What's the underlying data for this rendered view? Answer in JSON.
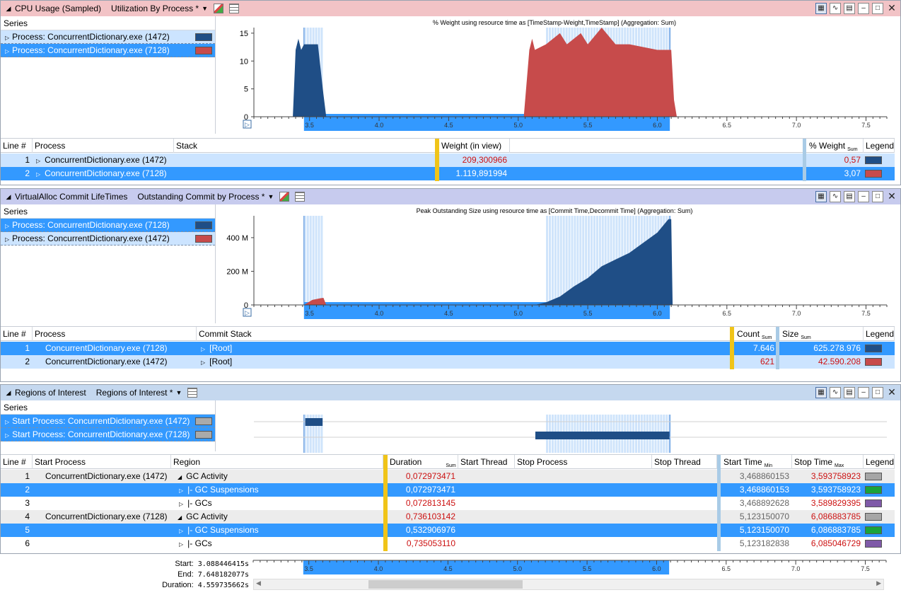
{
  "panels": [
    {
      "title": "CPU Usage (Sampled)",
      "preset": "Utilization By Process *",
      "color": "#f2c3c6",
      "series_header": "Series",
      "series": [
        {
          "label": "Process: ConcurrentDictionary.exe (1472)",
          "color": "#1f4e86"
        },
        {
          "label": "Process: ConcurrentDictionary.exe (7128)",
          "color": "#c74b4b"
        }
      ],
      "chart_title": "% Weight using resource time as [TimeStamp-Weight,TimeStamp] (Aggregation: Sum)",
      "yticks": [
        "15",
        "10",
        "5",
        "0"
      ],
      "columns": [
        "Line #",
        "Process",
        "Stack",
        "Weight (in view)",
        "% Weight",
        "Legend"
      ],
      "sum_label": "Sum",
      "rows": [
        {
          "line": "1",
          "process": "ConcurrentDictionary.exe (1472)",
          "stack": "",
          "weight": "209,300966",
          "pct": "0,57"
        },
        {
          "line": "2",
          "process": "ConcurrentDictionary.exe (7128)",
          "stack": "",
          "weight": "1.119,891994",
          "pct": "3,07"
        }
      ]
    },
    {
      "title": "VirtualAlloc Commit LifeTimes",
      "preset": "Outstanding Commit by Process *",
      "color": "#c7cbee",
      "series_header": "Series",
      "series": [
        {
          "label": "Process: ConcurrentDictionary.exe (7128)",
          "color": "#1f4e86"
        },
        {
          "label": "Process: ConcurrentDictionary.exe (1472)",
          "color": "#c74b4b"
        }
      ],
      "chart_title": "Peak Outstanding Size using resource time as [Commit Time,Decommit Time] (Aggregation: Sum)",
      "yticks": [
        "400 M",
        "200 M",
        "0"
      ],
      "columns": [
        "Line #",
        "Process",
        "Commit Stack",
        "Count",
        "Size",
        "Legend"
      ],
      "sum_label": "Sum",
      "rows": [
        {
          "line": "1",
          "process": "ConcurrentDictionary.exe (7128)",
          "stack": "[Root]",
          "count": "7.646",
          "size": "625.278.976"
        },
        {
          "line": "2",
          "process": "ConcurrentDictionary.exe (1472)",
          "stack": "[Root]",
          "count": "621",
          "size": "42.590.208"
        }
      ]
    },
    {
      "title": "Regions of Interest",
      "preset": "Regions of Interest *",
      "color": "#c5d8ef",
      "series_header": "Series",
      "series": [
        {
          "label": "Start Process: ConcurrentDictionary.exe (1472)",
          "color": "#aaaaaa"
        },
        {
          "label": "Start Process: ConcurrentDictionary.exe (7128)",
          "color": "#aaaaaa"
        }
      ],
      "columns": [
        "Line #",
        "Start Process",
        "Region",
        "Duration",
        "Start Thread",
        "Stop Process",
        "Stop Thread",
        "Start Time",
        "Stop Time",
        "Legend"
      ],
      "sum_label": "Sum",
      "min_label": "Min",
      "max_label": "Max",
      "rows": [
        {
          "line": "1",
          "process": "ConcurrentDictionary.exe (1472)",
          "region": "GC Activity",
          "duration": "0,072973471",
          "start": "3,468860153",
          "stop": "3,593758923",
          "legend": "#a6a6a6",
          "expanded": true
        },
        {
          "line": "2",
          "process": "",
          "region": "|- GC Suspensions",
          "duration": "0,072973471",
          "start": "3,468860153",
          "stop": "3,593758923",
          "legend": "#1aa33a",
          "expanded": false
        },
        {
          "line": "3",
          "process": "",
          "region": "|- GCs",
          "duration": "0,072813145",
          "start": "3,468892628",
          "stop": "3,589829395",
          "legend": "#7f5aa8",
          "expanded": false
        },
        {
          "line": "4",
          "process": "ConcurrentDictionary.exe (7128)",
          "region": "GC Activity",
          "duration": "0,736103142",
          "start": "5,123150070",
          "stop": "6,086883785",
          "legend": "#a6a6a6",
          "expanded": true
        },
        {
          "line": "5",
          "process": "",
          "region": "|- GC Suspensions",
          "duration": "0,532906976",
          "start": "5,123150070",
          "stop": "6,086883785",
          "legend": "#1aa33a",
          "expanded": false
        },
        {
          "line": "6",
          "process": "",
          "region": "|- GCs",
          "duration": "0,735053110",
          "start": "5,123182838",
          "stop": "6,085046729",
          "legend": "#7f5aa8",
          "expanded": false
        }
      ]
    }
  ],
  "xticks": [
    "3.5",
    "4.0",
    "4.5",
    "5.0",
    "5.5",
    "6.0",
    "6.5",
    "7.0",
    "7.5"
  ],
  "footer": {
    "start_label": "Start:",
    "start_value": "3.088446415s",
    "end_label": "End:",
    "end_value": "7.648182077s",
    "duration_label": "Duration:",
    "duration_value": "4.559735662s"
  },
  "chart_data": [
    {
      "type": "area",
      "title": "% Weight using resource time as [TimeStamp-Weight,TimeStamp] (Aggregation: Sum)",
      "xlim": [
        3.1,
        7.65
      ],
      "ylim": [
        0,
        16
      ],
      "series": [
        {
          "name": "Process: ConcurrentDictionary.exe (1472)",
          "x": [
            3.38,
            3.4,
            3.42,
            3.44,
            3.46,
            3.48,
            3.5,
            3.52,
            3.56,
            3.6,
            3.62
          ],
          "y": [
            0,
            12,
            14,
            12,
            13,
            13,
            13,
            13,
            13,
            4,
            0
          ]
        },
        {
          "name": "Process: ConcurrentDictionary.exe (7128)",
          "x": [
            5.04,
            5.08,
            5.1,
            5.12,
            5.2,
            5.3,
            5.35,
            5.45,
            5.5,
            5.6,
            5.7,
            5.8,
            6.0,
            6.1,
            6.12,
            6.14
          ],
          "y": [
            0,
            12,
            14,
            12,
            13,
            15,
            13,
            15,
            13,
            16,
            13,
            13,
            12,
            12,
            3,
            0
          ]
        }
      ]
    },
    {
      "type": "area",
      "title": "Peak Outstanding Size using resource time as [Commit Time,Decommit Time] (Aggregation: Sum)",
      "xlim": [
        3.1,
        7.65
      ],
      "ylim": [
        0,
        530
      ],
      "series": [
        {
          "name": "Process: ConcurrentDictionary.exe (7128)",
          "x": [
            5.12,
            5.2,
            5.3,
            5.4,
            5.5,
            5.6,
            5.7,
            5.8,
            5.9,
            6.0,
            6.08,
            6.1,
            6.11
          ],
          "y": [
            0,
            15,
            50,
            110,
            160,
            230,
            270,
            310,
            370,
            430,
            510,
            510,
            0
          ]
        },
        {
          "name": "Process: ConcurrentDictionary.exe (1472)",
          "x": [
            3.46,
            3.52,
            3.58,
            3.6,
            3.62
          ],
          "y": [
            0,
            30,
            40,
            42,
            0
          ]
        }
      ]
    },
    {
      "type": "table",
      "title": "",
      "xlim": [
        3.1,
        7.65
      ],
      "series": [
        {
          "name": "Start Process: ConcurrentDictionary.exe (1472)",
          "x": [
            3.4689,
            3.5938
          ]
        },
        {
          "name": "Start Process: ConcurrentDictionary.exe (7128)",
          "x": [
            5.1232,
            6.0869
          ]
        }
      ]
    }
  ]
}
